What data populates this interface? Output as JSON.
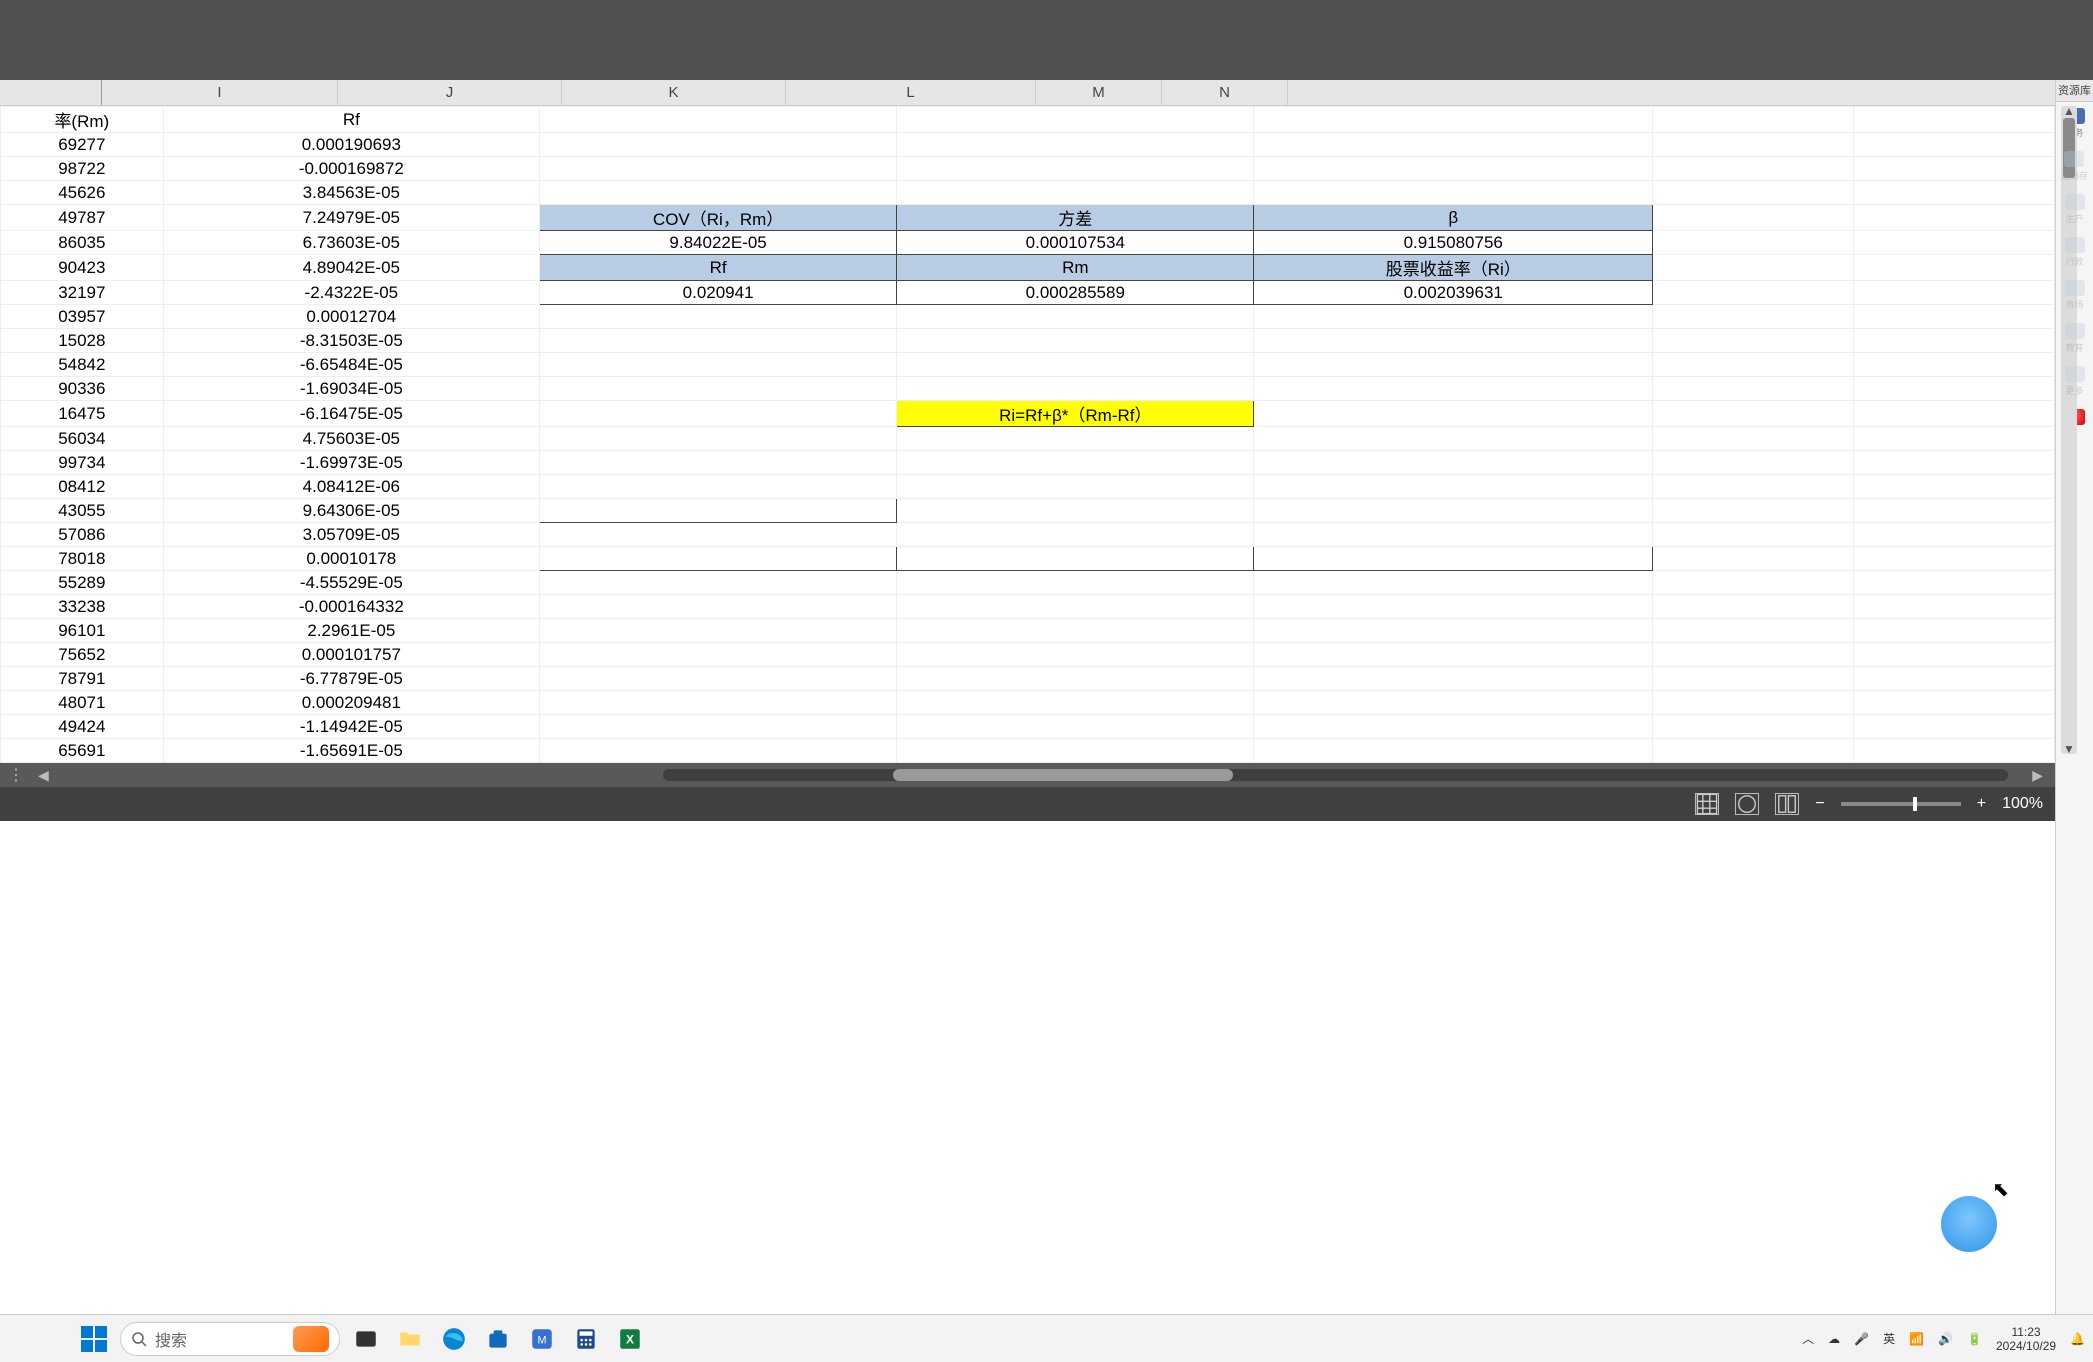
{
  "columns": {
    "H": "率(Rm)",
    "I": "Rf",
    "J": "J",
    "K": "K",
    "L": "L",
    "M": "M",
    "N": "N",
    "colI_label": "I"
  },
  "rows": [
    {
      "H": "69277",
      "I": "0.000190693"
    },
    {
      "H": "98722",
      "I": "-0.000169872"
    },
    {
      "H": "45626",
      "I": "3.84563E-05"
    },
    {
      "H": "49787",
      "I": "7.24979E-05"
    },
    {
      "H": "86035",
      "I": "6.73603E-05"
    },
    {
      "H": "90423",
      "I": "4.89042E-05"
    },
    {
      "H": "32197",
      "I": "-2.4322E-05"
    },
    {
      "H": "03957",
      "I": "0.00012704"
    },
    {
      "H": "15028",
      "I": "-8.31503E-05"
    },
    {
      "H": "54842",
      "I": "-6.65484E-05"
    },
    {
      "H": "90336",
      "I": "-1.69034E-05"
    },
    {
      "H": "16475",
      "I": "-6.16475E-05"
    },
    {
      "H": "56034",
      "I": "4.75603E-05"
    },
    {
      "H": "99734",
      "I": "-1.69973E-05"
    },
    {
      "H": "08412",
      "I": "4.08412E-06"
    },
    {
      "H": "43055",
      "I": "9.64306E-05"
    },
    {
      "H": "57086",
      "I": "3.05709E-05"
    },
    {
      "H": "78018",
      "I": "0.00010178"
    },
    {
      "H": "55289",
      "I": "-4.55529E-05"
    },
    {
      "H": "33238",
      "I": "-0.000164332"
    },
    {
      "H": "96101",
      "I": "2.2961E-05"
    },
    {
      "H": "75652",
      "I": "0.000101757"
    },
    {
      "H": "78791",
      "I": "-6.77879E-05"
    },
    {
      "H": "48071",
      "I": "0.000209481"
    },
    {
      "H": "49424",
      "I": "-1.14942E-05"
    },
    {
      "H": "65691",
      "I": "-1.65691E-05"
    }
  ],
  "model_table": {
    "r1": {
      "J": "COV（Ri，Rm）",
      "K": "方差",
      "L": "β"
    },
    "r2": {
      "J": "9.84022E-05",
      "K": "0.000107534",
      "L": "0.915080756"
    },
    "r3": {
      "J": "Rf",
      "K": "Rm",
      "L": "股票收益率（Ri）"
    },
    "r4": {
      "J": "0.020941",
      "K": "0.000285589",
      "L": "0.002039631"
    }
  },
  "formula": "Ri=Rf+β*（Rm-Rf）",
  "right_panel": {
    "title": "资源库▾",
    "items": [
      {
        "label": "财务"
      },
      {
        "label": "进销存"
      },
      {
        "label": "生产"
      },
      {
        "label": "行政"
      },
      {
        "label": "市场"
      },
      {
        "label": "教育"
      },
      {
        "label": "更多"
      }
    ]
  },
  "status": {
    "zoom": "100%"
  },
  "taskbar": {
    "search_placeholder": "搜索",
    "ime": "英",
    "time": "11:23",
    "date": "2024/10/29"
  }
}
